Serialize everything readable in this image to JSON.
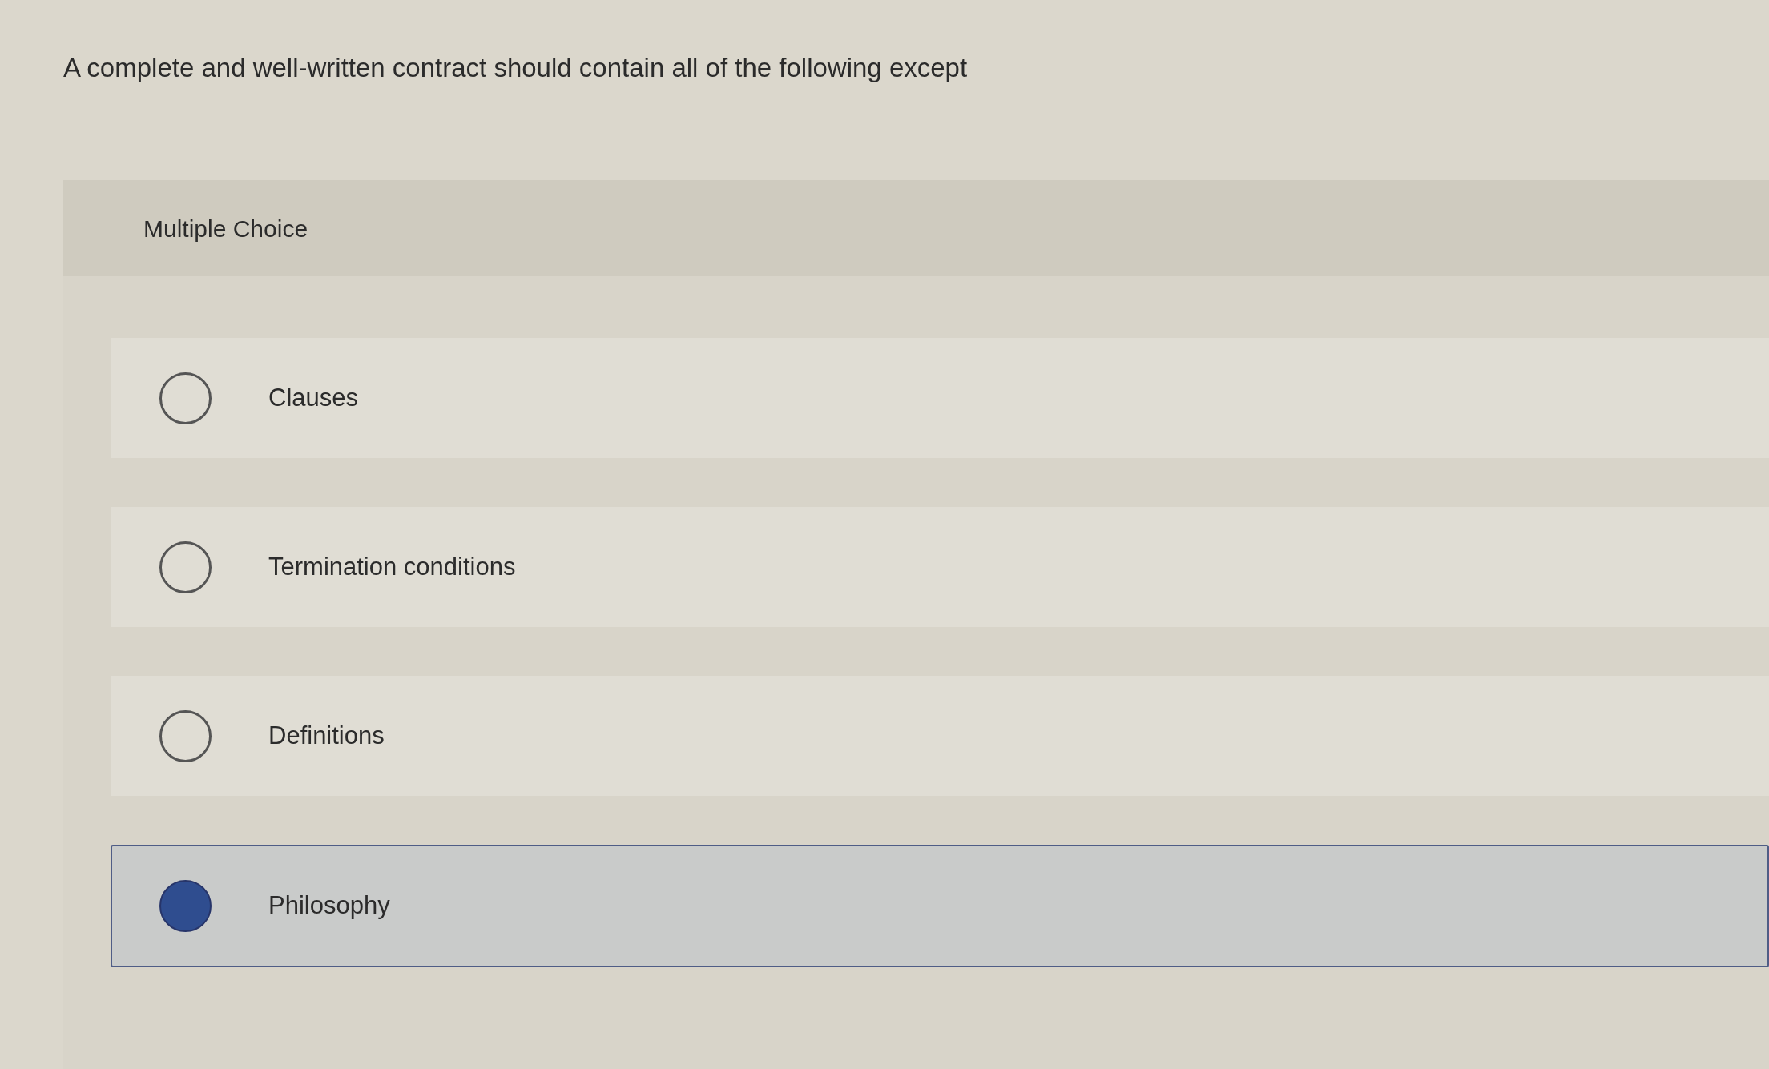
{
  "question": "A complete and well-written contract should contain all of the following except",
  "question_type": "Multiple Choice",
  "options": [
    {
      "label": "Clauses",
      "selected": false
    },
    {
      "label": "Termination conditions",
      "selected": false
    },
    {
      "label": "Definitions",
      "selected": false
    },
    {
      "label": "Philosophy",
      "selected": true
    }
  ]
}
